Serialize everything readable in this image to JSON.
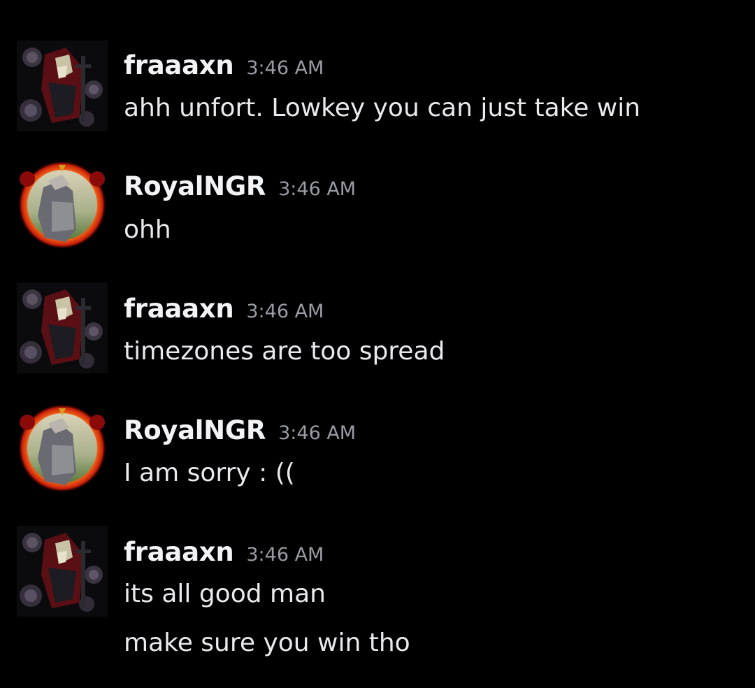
{
  "theme": {
    "background": "#000000",
    "username_color": "#f2f3f5",
    "timestamp_color": "#9a9ca3",
    "text_color": "#e9eaec"
  },
  "messages": [
    {
      "author": "fraaaxn",
      "avatar_icon": "dark-roses-knight-avatar-icon",
      "time": "3:46 AM",
      "lines": [
        "ahh unfort. Lowkey you can just take win"
      ]
    },
    {
      "author": "RoyalNGR",
      "avatar_icon": "fire-ring-warrior-avatar-icon",
      "time": "3:46 AM",
      "lines": [
        "ohh"
      ]
    },
    {
      "author": "fraaaxn",
      "avatar_icon": "dark-roses-knight-avatar-icon",
      "time": "3:46 AM",
      "lines": [
        "timezones are too spread"
      ]
    },
    {
      "author": "RoyalNGR",
      "avatar_icon": "fire-ring-warrior-avatar-icon",
      "time": "3:46 AM",
      "lines": [
        "I am sorry : (("
      ]
    },
    {
      "author": "fraaaxn",
      "avatar_icon": "dark-roses-knight-avatar-icon",
      "time": "3:46 AM",
      "lines": [
        "its all good man",
        "make sure you win tho"
      ]
    }
  ]
}
